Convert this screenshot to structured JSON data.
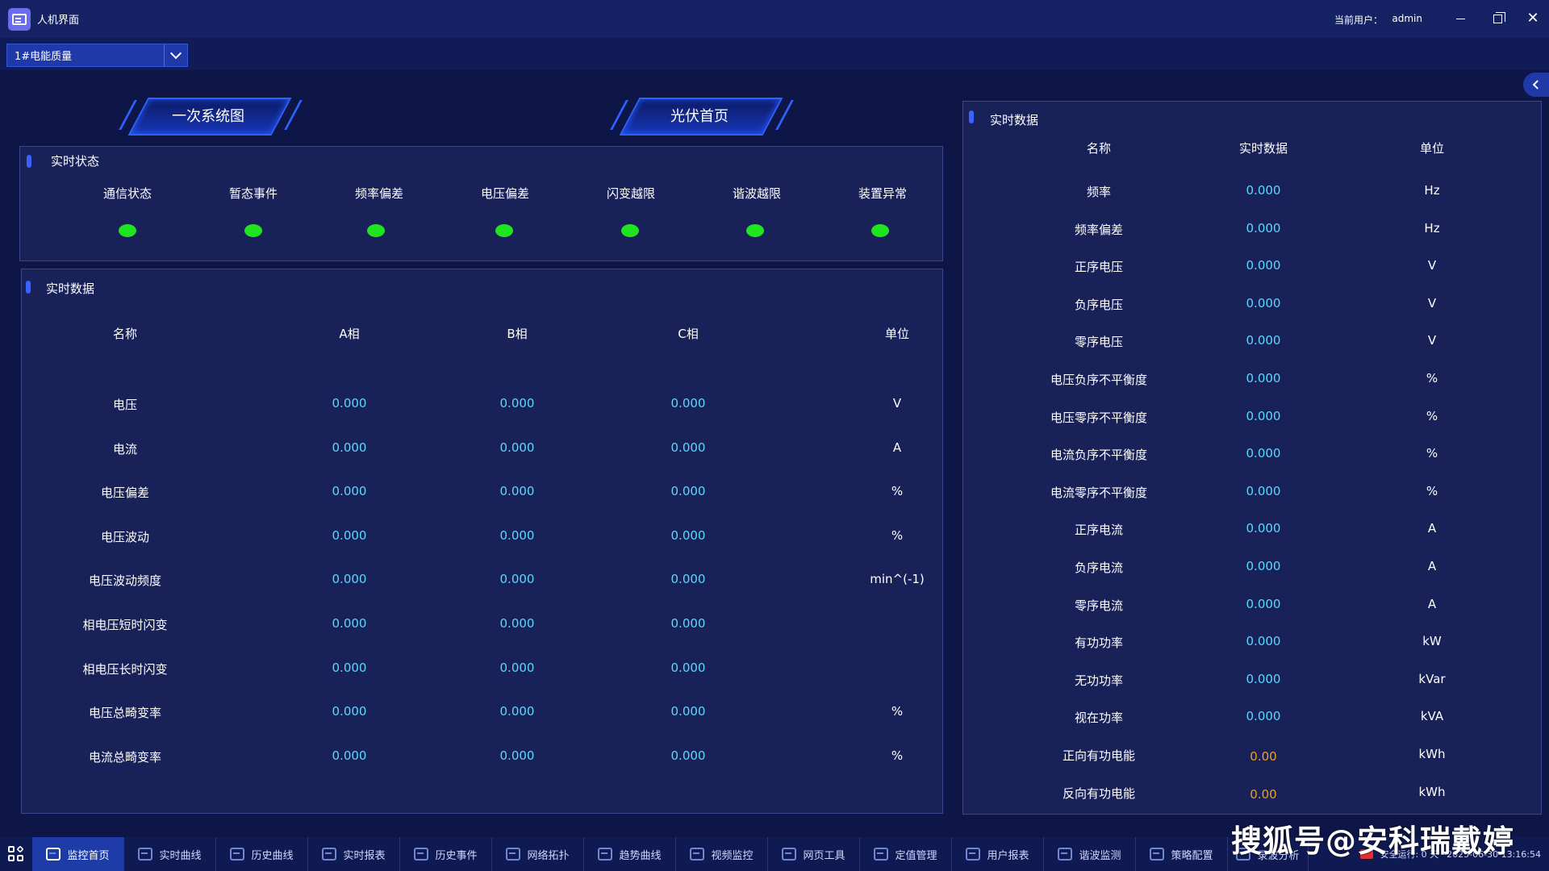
{
  "window": {
    "title": "人机界面",
    "user_label": "当前用户：",
    "user_name": "admin"
  },
  "selector": {
    "value": "1#电能质量"
  },
  "tabs": [
    {
      "label": "一次系统图"
    },
    {
      "label": "光伏首页"
    }
  ],
  "status_panel": {
    "title": "实时状态",
    "items": [
      {
        "label": "通信状态",
        "color": "#21e420"
      },
      {
        "label": "暂态事件",
        "color": "#21e420"
      },
      {
        "label": "频率偏差",
        "color": "#21e420"
      },
      {
        "label": "电压偏差",
        "color": "#21e420"
      },
      {
        "label": "闪变越限",
        "color": "#21e420"
      },
      {
        "label": "谐波越限",
        "color": "#21e420"
      },
      {
        "label": "装置异常",
        "color": "#21e420"
      }
    ]
  },
  "phase_table": {
    "title": "实时数据",
    "headers": [
      "名称",
      "A相",
      "B相",
      "C相",
      "单位"
    ],
    "rows": [
      {
        "name": "电压",
        "a": "0.000",
        "b": "0.000",
        "c": "0.000",
        "unit": "V"
      },
      {
        "name": "电流",
        "a": "0.000",
        "b": "0.000",
        "c": "0.000",
        "unit": "A"
      },
      {
        "name": "电压偏差",
        "a": "0.000",
        "b": "0.000",
        "c": "0.000",
        "unit": "%"
      },
      {
        "name": "电压波动",
        "a": "0.000",
        "b": "0.000",
        "c": "0.000",
        "unit": "%"
      },
      {
        "name": "电压波动频度",
        "a": "0.000",
        "b": "0.000",
        "c": "0.000",
        "unit": "min^(-1)"
      },
      {
        "name": "相电压短时闪变",
        "a": "0.000",
        "b": "0.000",
        "c": "0.000",
        "unit": ""
      },
      {
        "name": "相电压长时闪变",
        "a": "0.000",
        "b": "0.000",
        "c": "0.000",
        "unit": ""
      },
      {
        "name": "电压总畸变率",
        "a": "0.000",
        "b": "0.000",
        "c": "0.000",
        "unit": "%"
      },
      {
        "name": "电流总畸变率",
        "a": "0.000",
        "b": "0.000",
        "c": "0.000",
        "unit": "%"
      }
    ]
  },
  "right_table": {
    "title": "实时数据",
    "headers": [
      "名称",
      "实时数据",
      "单位"
    ],
    "rows": [
      {
        "name": "频率",
        "value": "0.000",
        "unit": "Hz"
      },
      {
        "name": "频率偏差",
        "value": "0.000",
        "unit": "Hz"
      },
      {
        "name": "正序电压",
        "value": "0.000",
        "unit": "V"
      },
      {
        "name": "负序电压",
        "value": "0.000",
        "unit": "V"
      },
      {
        "name": "零序电压",
        "value": "0.000",
        "unit": "V"
      },
      {
        "name": "电压负序不平衡度",
        "value": "0.000",
        "unit": "%"
      },
      {
        "name": "电压零序不平衡度",
        "value": "0.000",
        "unit": "%"
      },
      {
        "name": "电流负序不平衡度",
        "value": "0.000",
        "unit": "%"
      },
      {
        "name": "电流零序不平衡度",
        "value": "0.000",
        "unit": "%"
      },
      {
        "name": "正序电流",
        "value": "0.000",
        "unit": "A"
      },
      {
        "name": "负序电流",
        "value": "0.000",
        "unit": "A"
      },
      {
        "name": "零序电流",
        "value": "0.000",
        "unit": "A"
      },
      {
        "name": "有功功率",
        "value": "0.000",
        "unit": "kW"
      },
      {
        "name": "无功功率",
        "value": "0.000",
        "unit": "kVar"
      },
      {
        "name": "视在功率",
        "value": "0.000",
        "unit": "kVA"
      },
      {
        "name": "正向有功电能",
        "value": "0.00",
        "unit": "kWh",
        "energy": true
      },
      {
        "name": "反向有功电能",
        "value": "0.00",
        "unit": "kWh",
        "energy": true
      }
    ]
  },
  "taskbar": {
    "items": [
      {
        "label": "监控首页",
        "active": true
      },
      {
        "label": "实时曲线"
      },
      {
        "label": "历史曲线"
      },
      {
        "label": "实时报表"
      },
      {
        "label": "历史事件"
      },
      {
        "label": "网络拓扑"
      },
      {
        "label": "趋势曲线"
      },
      {
        "label": "视频监控"
      },
      {
        "label": "网页工具"
      },
      {
        "label": "定值管理"
      },
      {
        "label": "用户报表"
      },
      {
        "label": "谐波监测"
      },
      {
        "label": "策略配置"
      },
      {
        "label": "录波分析"
      }
    ],
    "run_status": "安全运行: 0 天",
    "datetime": "2025-06-30 13:16:54"
  },
  "watermark": "搜狐号@安科瑞戴婷"
}
